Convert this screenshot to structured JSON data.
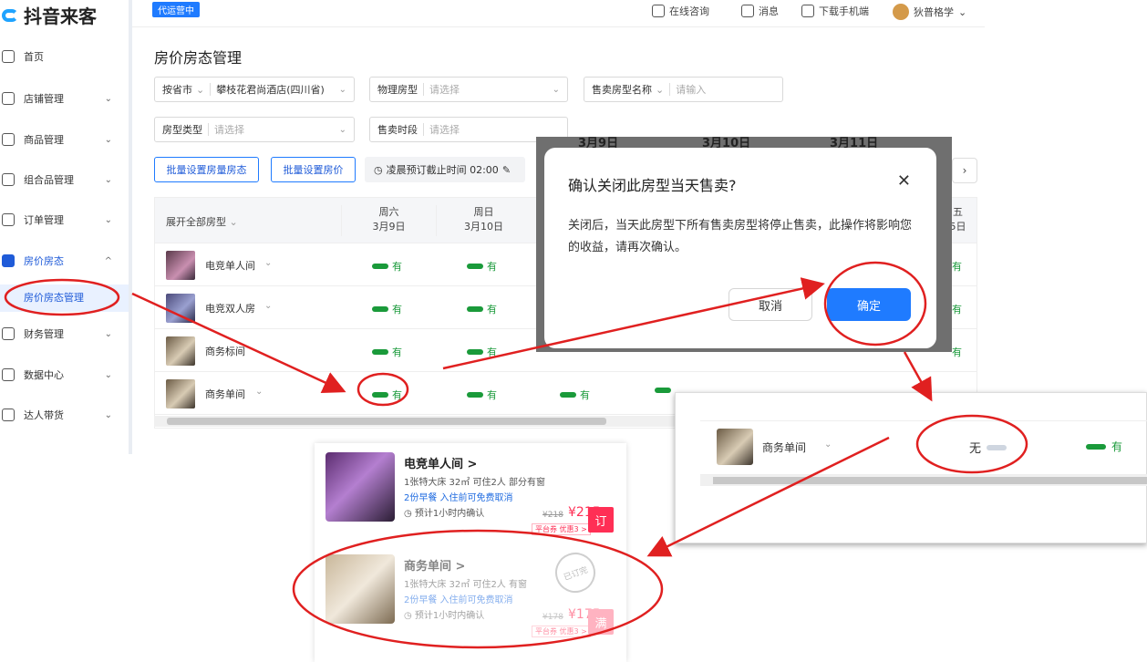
{
  "app": {
    "logo_text": "抖音来客",
    "badge": "代运营中"
  },
  "header": {
    "items": [
      {
        "label": "在线咨询",
        "icon": "headset-icon"
      },
      {
        "label": "消息",
        "icon": "bell-icon"
      },
      {
        "label": "下载手机端",
        "icon": "phone-icon"
      },
      {
        "label": "狄普格学",
        "icon": "avatar"
      }
    ]
  },
  "sidebar": {
    "items": [
      {
        "label": "首页",
        "icon": "home-icon"
      },
      {
        "label": "店铺管理",
        "icon": "shop-icon"
      },
      {
        "label": "商品管理",
        "icon": "goods-icon"
      },
      {
        "label": "组合品管理",
        "icon": "bundle-icon"
      },
      {
        "label": "订单管理",
        "icon": "order-icon"
      },
      {
        "label": "房价房态",
        "icon": "hotel-icon"
      },
      {
        "label": "财务管理",
        "icon": "wallet-icon"
      },
      {
        "label": "数据中心",
        "icon": "chart-icon"
      },
      {
        "label": "达人带货",
        "icon": "bag-icon"
      }
    ],
    "sub_active": "房价房态管理"
  },
  "page": {
    "title": "房价房态管理"
  },
  "filters": {
    "province_label": "按省市",
    "hotel_value": "攀枝花君尚酒店(四川省)",
    "physical_label": "物理房型",
    "physical_placeholder": "请选择",
    "sale_name_label": "售卖房型名称",
    "sale_name_placeholder": "请输入",
    "room_type_label": "房型类型",
    "room_type_placeholder": "请选择",
    "period_label": "售卖时段",
    "period_placeholder": "请选择"
  },
  "actions": {
    "batch_status": "批量设置房量房态",
    "batch_price": "批量设置房价",
    "cutoff": "凌晨预订截止时间 02:00"
  },
  "table": {
    "room_header": "展开全部房型",
    "days": [
      {
        "weekday": "周六",
        "date": "3月9日"
      },
      {
        "weekday": "周日",
        "date": "3月10日"
      }
    ],
    "rooms": [
      {
        "name": "电竞单人间"
      },
      {
        "name": "电竞双人房"
      },
      {
        "name": "商务标间"
      },
      {
        "name": "商务单间"
      }
    ],
    "status_yes": "有",
    "peek_day": {
      "weekday": "五",
      "date": "5日"
    }
  },
  "dialog": {
    "header_dates": [
      "3月9日",
      "3月10日",
      "3月11日"
    ],
    "title": "确认关闭此房型当天售卖?",
    "body": "关闭后，当天此房型下所有售卖房型将停止售卖，此操作将影响您的收益，请再次确认。",
    "cancel": "取消",
    "confirm": "确定"
  },
  "inset": {
    "room_name": "商务单间",
    "status_none": "无",
    "status_yes": "有"
  },
  "mobile": {
    "cards": [
      {
        "title": "电竞单人间 >",
        "line1": "1张特大床  32㎡  可住2人  部分有窗",
        "line2": "2份早餐  入住前可免费取消",
        "line3": "预计1小时内确认",
        "old_price": "¥218",
        "price": "¥215",
        "coupon": "平台券  优惠3 >",
        "button": "订"
      },
      {
        "title": "商务单间 >",
        "line1": "1张特大床  32㎡  可住2人  有窗",
        "line2": "2份早餐  入住前可免费取消",
        "line3": "预计1小时内确认",
        "old_price": "¥178",
        "price": "¥175",
        "coupon": "平台券  优惠3 >",
        "button": "满",
        "stamp": "已订完"
      }
    ]
  },
  "colors": {
    "accent": "#1f7bff",
    "status_green": "#1a9a3a",
    "annotation_red": "#e02020",
    "price_red": "#ff2f55"
  }
}
